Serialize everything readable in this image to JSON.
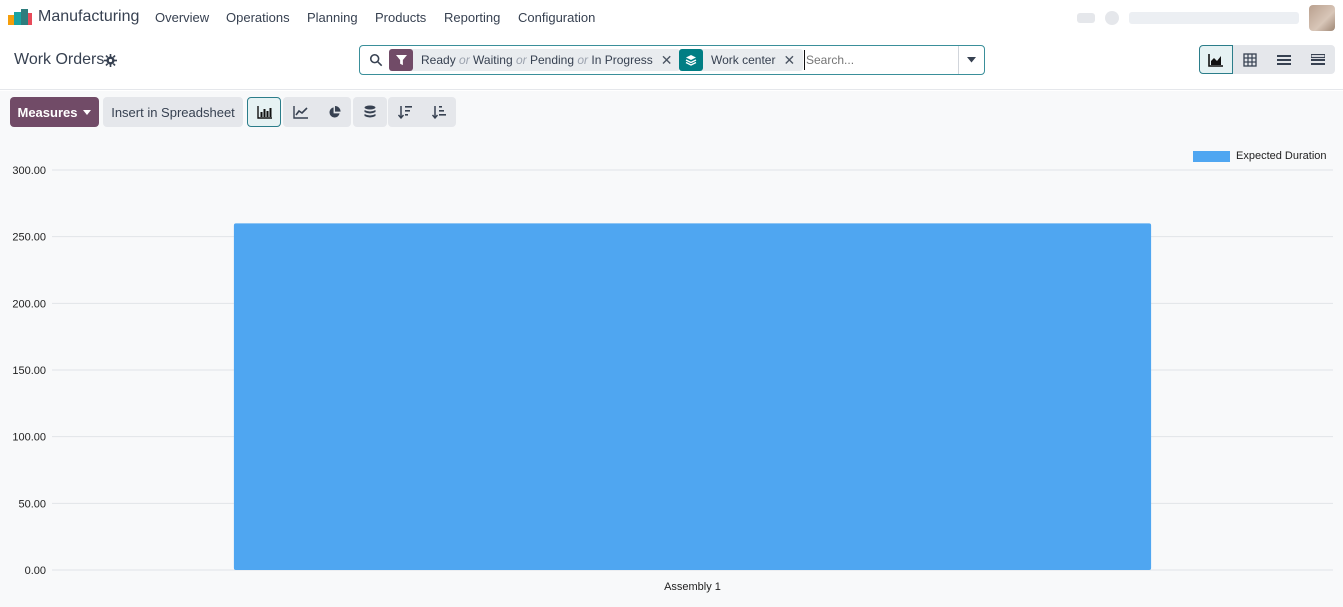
{
  "app": {
    "name": "Manufacturing"
  },
  "nav": {
    "menus": [
      "Overview",
      "Operations",
      "Planning",
      "Products",
      "Reporting",
      "Configuration"
    ]
  },
  "control_panel": {
    "title": "Work Orders",
    "search": {
      "facets": [
        {
          "type": "filter",
          "values": [
            "Ready",
            "Waiting",
            "Pending",
            "In Progress"
          ],
          "separator": "or",
          "badge_color": "#714b67"
        },
        {
          "type": "groupby",
          "values": [
            "Work center"
          ],
          "badge_color": "#017e84"
        }
      ],
      "placeholder": "Search..."
    },
    "views": [
      {
        "name": "graph",
        "active": true
      },
      {
        "name": "pivot",
        "active": false
      },
      {
        "name": "list",
        "active": false
      },
      {
        "name": "kanban",
        "active": false
      }
    ]
  },
  "toolbar": {
    "measures_label": "Measures",
    "spreadsheet_label": "Insert in Spreadsheet",
    "buttons": [
      "bar-chart-icon",
      "line-chart-icon",
      "pie-chart-icon",
      "stacked-icon",
      "sort-descending-icon",
      "sort-ascending-icon"
    ]
  },
  "chart_data": {
    "type": "bar",
    "categories": [
      "Assembly 1"
    ],
    "series": [
      {
        "name": "Expected Duration",
        "values": [
          260
        ],
        "color": "#4fa6f1"
      }
    ],
    "ylim": [
      0,
      300
    ],
    "yticks": [
      "0.00",
      "50.00",
      "100.00",
      "150.00",
      "200.00",
      "250.00",
      "300.00"
    ],
    "grid": true,
    "legend": "top-right"
  },
  "colors": {
    "primary": "#714b67",
    "accent": "#017e84",
    "bar": "#4fa6f1"
  }
}
